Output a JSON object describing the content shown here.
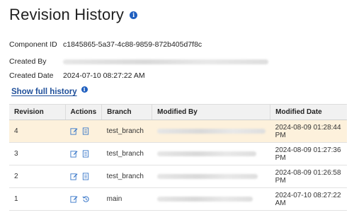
{
  "page": {
    "title": "Revision History"
  },
  "details": {
    "component_id_label": "Component ID",
    "component_id_value": "c1845865-5a37-4c88-9859-872b405d7f8c",
    "created_by_label": "Created By",
    "created_date_label": "Created Date",
    "created_date_value": "2024-07-10 08:27:22 AM"
  },
  "show_full_history_label": "Show full history",
  "table": {
    "headers": {
      "revision": "Revision",
      "actions": "Actions",
      "branch": "Branch",
      "modified_by": "Modified By",
      "modified_date": "Modified Date"
    },
    "rows": [
      {
        "revision": "4",
        "branch": "test_branch",
        "modified_date": "2024-08-09 01:28:44 PM",
        "selected": true,
        "second_action_icon": "document-icon"
      },
      {
        "revision": "3",
        "branch": "test_branch",
        "modified_date": "2024-08-09 01:27:36 PM",
        "selected": false,
        "second_action_icon": "document-icon"
      },
      {
        "revision": "2",
        "branch": "test_branch",
        "modified_date": "2024-08-09 01:26:58 PM",
        "selected": false,
        "second_action_icon": "document-icon"
      },
      {
        "revision": "1",
        "branch": "main",
        "modified_date": "2024-07-10 08:27:22 AM",
        "selected": false,
        "second_action_icon": "restore-icon"
      }
    ]
  },
  "colors": {
    "link": "#1f4f9a",
    "info_icon": "#1f5fbf",
    "selected_row": "#fdf1dc",
    "action_icon": "#3a78c9"
  }
}
